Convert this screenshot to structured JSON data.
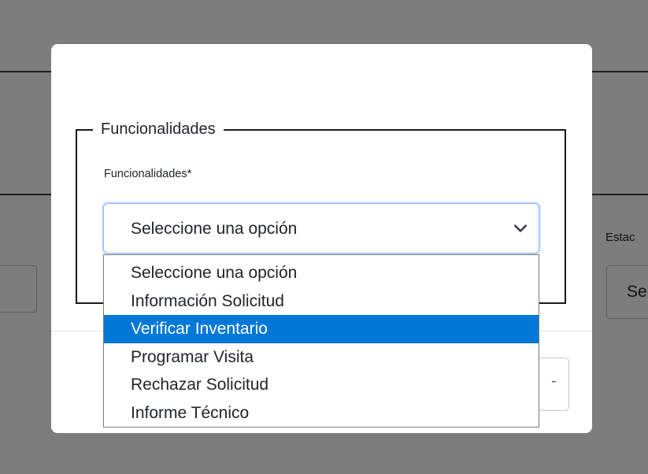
{
  "background": {
    "label_partial": "Estac",
    "input_partial": "Se"
  },
  "modal": {
    "fieldset_legend": "Funcionalidades",
    "field_label": "Funcionalidades",
    "required_mark": "*",
    "select": {
      "value": "Seleccione una opción"
    },
    "footer_button_glyph": "-"
  },
  "dropdown": {
    "options": [
      {
        "label": "Seleccione una opción",
        "selected": false
      },
      {
        "label": "Información Solicitud",
        "selected": false
      },
      {
        "label": "Verificar Inventario",
        "selected": true
      },
      {
        "label": "Programar Visita",
        "selected": false
      },
      {
        "label": "Rechazar Solicitud",
        "selected": false
      },
      {
        "label": "Informe Técnico",
        "selected": false
      }
    ]
  },
  "colors": {
    "overlay": "#7d7d7d",
    "highlight": "#0078d7",
    "focus_border": "#86b7fe"
  }
}
